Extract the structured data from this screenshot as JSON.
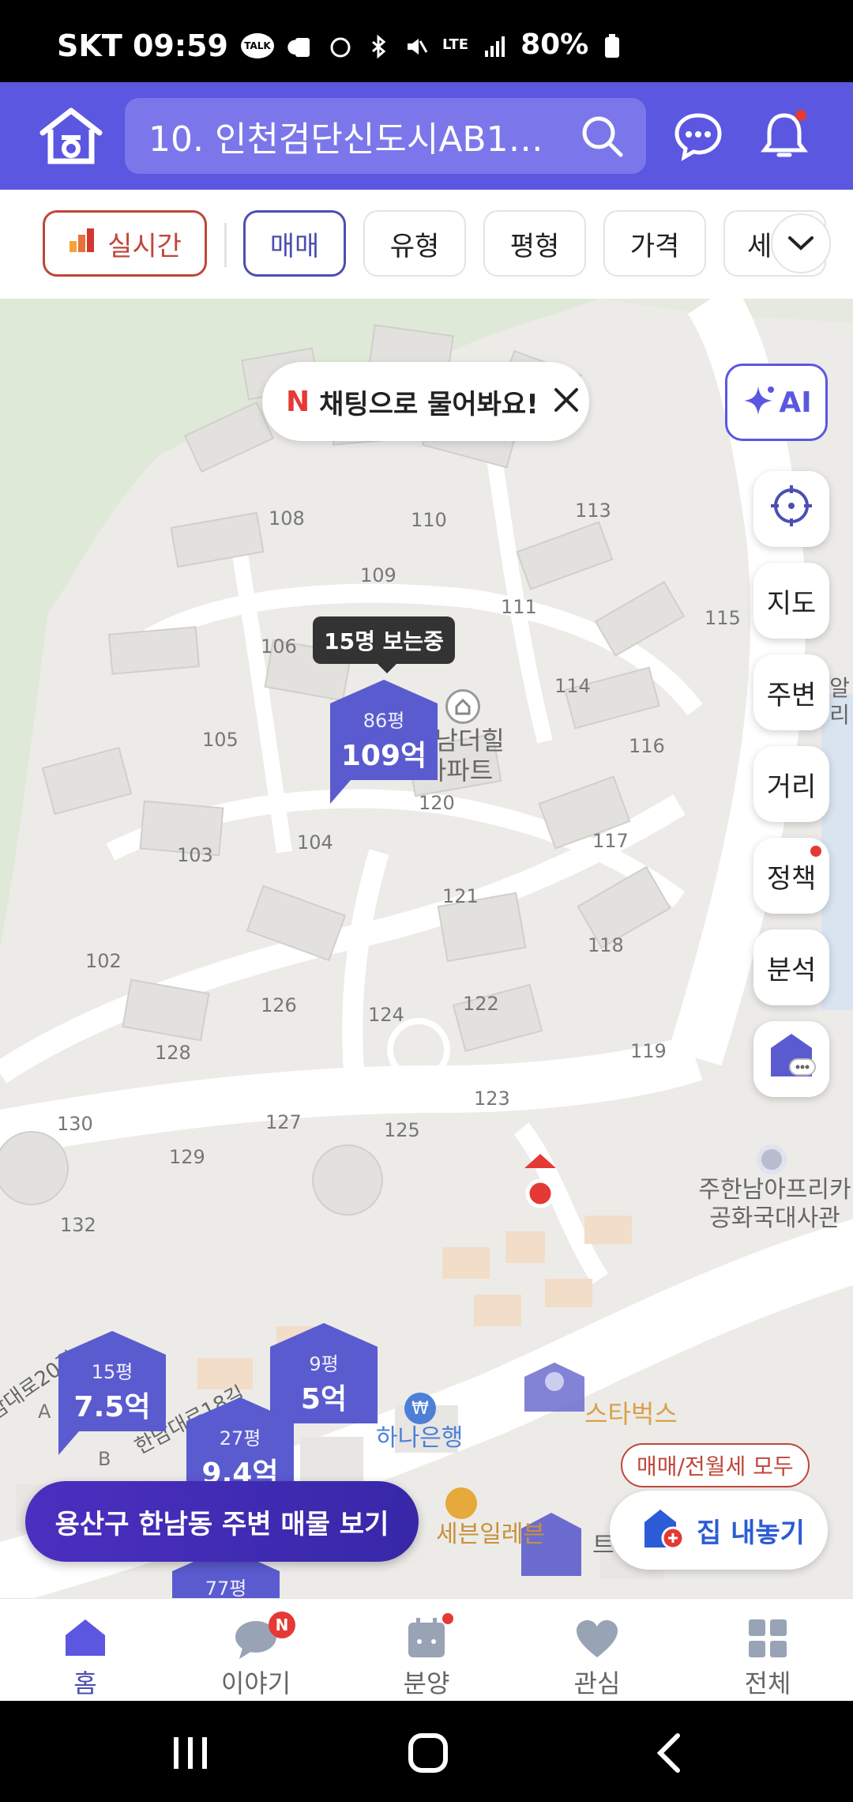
{
  "status_bar": {
    "carrier_time": "SKT 09:59",
    "talk_badge": "TALK",
    "network": "LTE",
    "battery": "80%"
  },
  "header": {
    "search_text": "10. 인천검단신도시AB13...",
    "icons": [
      "home-logo-icon",
      "search-icon",
      "chat-icon",
      "bell-icon"
    ]
  },
  "filters": {
    "realtime": "실시간",
    "items": [
      "매매",
      "유형",
      "평형",
      "가격",
      "세"
    ]
  },
  "map": {
    "chat_prompt": {
      "prefix": "N",
      "text": "채팅으로 물어봐요!"
    },
    "ai_button": "AI",
    "side_buttons": [
      "지도",
      "주변",
      "거리",
      "정책",
      "분석"
    ],
    "tooltip": "15명 보는중",
    "complex_name": "한남더힐\n아파트",
    "embassy_label": "주한남아프리카\n공화국대사관",
    "bank_label": "하나은행",
    "store_label": "세븐일레븐",
    "cafe_label": "스타벅스",
    "partial_label": "트",
    "road_labels": [
      "한남대로18길",
      "남대로20길"
    ],
    "side_partial_label": "알리",
    "building_numbers": [
      "108",
      "110",
      "113",
      "109",
      "111",
      "106",
      "115",
      "114",
      "105",
      "116",
      "120",
      "104",
      "103",
      "117",
      "121",
      "118",
      "102",
      "126",
      "124",
      "122",
      "128",
      "119",
      "130",
      "127",
      "125",
      "123",
      "129",
      "132",
      "A",
      "B"
    ],
    "pins": [
      {
        "area": "86평",
        "price": "109억"
      },
      {
        "area": "15평",
        "price": "7.5억"
      },
      {
        "area": "9평",
        "price": "5억"
      },
      {
        "area": "27평",
        "price": "9.4억"
      },
      {
        "area": "77평",
        "price": ""
      }
    ],
    "nearby_button": "용산구 한남동 주변 매물 보기",
    "list_tag": "매매/전월세 모두",
    "list_button": "집 내놓기"
  },
  "bottom_nav": {
    "items": [
      "홈",
      "이야기",
      "분양",
      "관심",
      "전체"
    ],
    "story_badge": "N"
  },
  "colors": {
    "brand": "#5b57e0",
    "pin": "#5b5bd0",
    "realtime": "#c0463a",
    "alert": "#e53935"
  }
}
